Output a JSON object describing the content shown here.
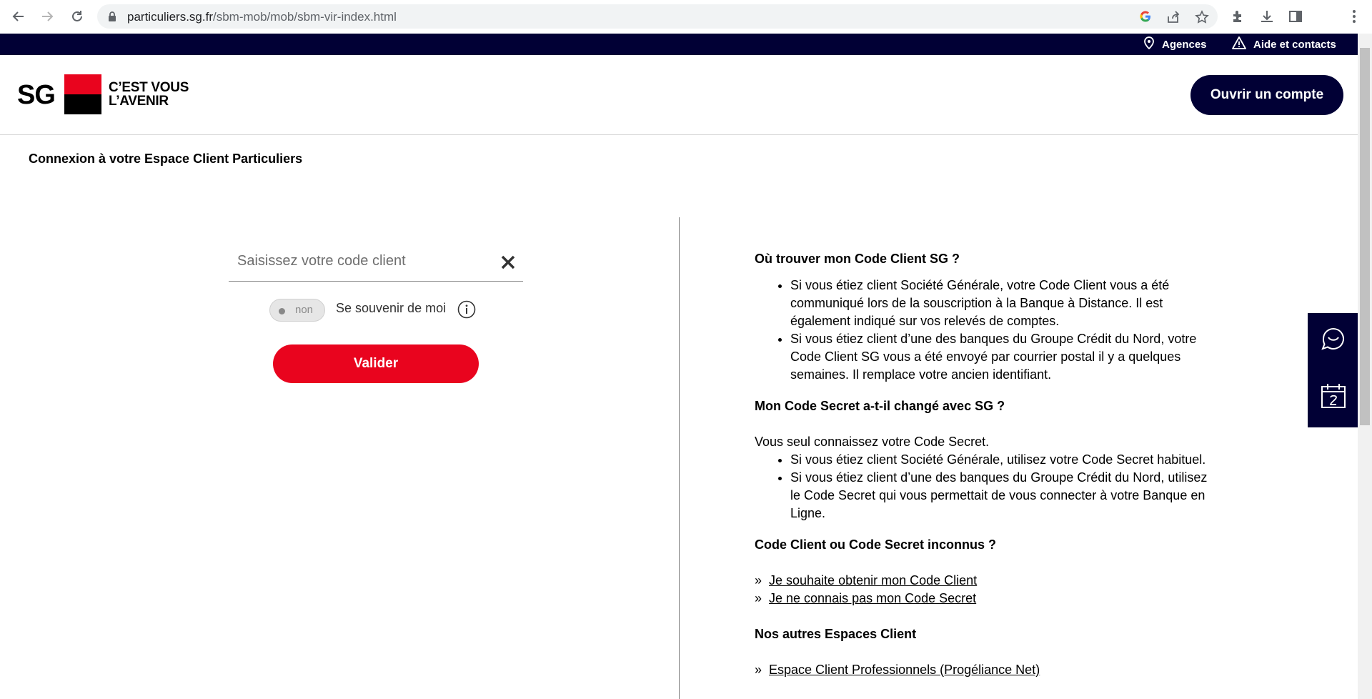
{
  "browser": {
    "url_host": "particuliers.sg.fr",
    "url_path": "/sbm-mob/mob/sbm-vir-index.html"
  },
  "topbar": {
    "agencies": "Agences",
    "help": "Aide et contacts"
  },
  "header": {
    "logo_text": "SG",
    "slogan_line1": "C’EST VOUS",
    "slogan_line2": "L’AVENIR",
    "open_account": "Ouvrir un compte"
  },
  "page_title": "Connexion à votre Espace Client Particuliers",
  "login": {
    "placeholder": "Saisissez votre code client",
    "toggle_label": "non",
    "remember_label": "Se souvenir de moi",
    "validate": "Valider"
  },
  "help": {
    "q1": "Où trouver mon Code Client SG ?",
    "q1_items": [
      "Si vous étiez client Société Générale, votre Code Client vous a été communiqué lors de la souscription à la Banque à Distance. Il est également indiqué sur vos relevés de comptes.",
      "Si vous étiez client d’une des banques du Groupe Crédit du Nord, votre Code Client SG vous a été envoyé par courrier postal il y a quelques semaines. Il remplace votre ancien identifiant."
    ],
    "q2": "Mon Code Secret a-t-il changé avec SG ?",
    "q2_intro": "Vous seul connaissez votre Code Secret.",
    "q2_items": [
      "Si vous étiez client Société Générale, utilisez votre Code Secret habituel.",
      "Si vous étiez client d’une des banques du Groupe Crédit du Nord, utilisez le Code Secret qui vous permettait de vous connecter à votre Banque en Ligne."
    ],
    "q3": "Code Client ou Code Secret inconnus ?",
    "q3_links": [
      "Je souhaite obtenir mon Code Client",
      "Je ne connais pas mon Code Secret"
    ],
    "q4": "Nos autres Espaces Client",
    "q4_links": [
      "Espace Client Professionnels (Progéliance Net)"
    ]
  },
  "icons": {
    "location": "location-pin-icon",
    "warning": "warning-icon",
    "chat": "chat-icon",
    "calendar": "calendar-icon"
  },
  "colors": {
    "navy": "#010035",
    "red": "#e9041e"
  }
}
